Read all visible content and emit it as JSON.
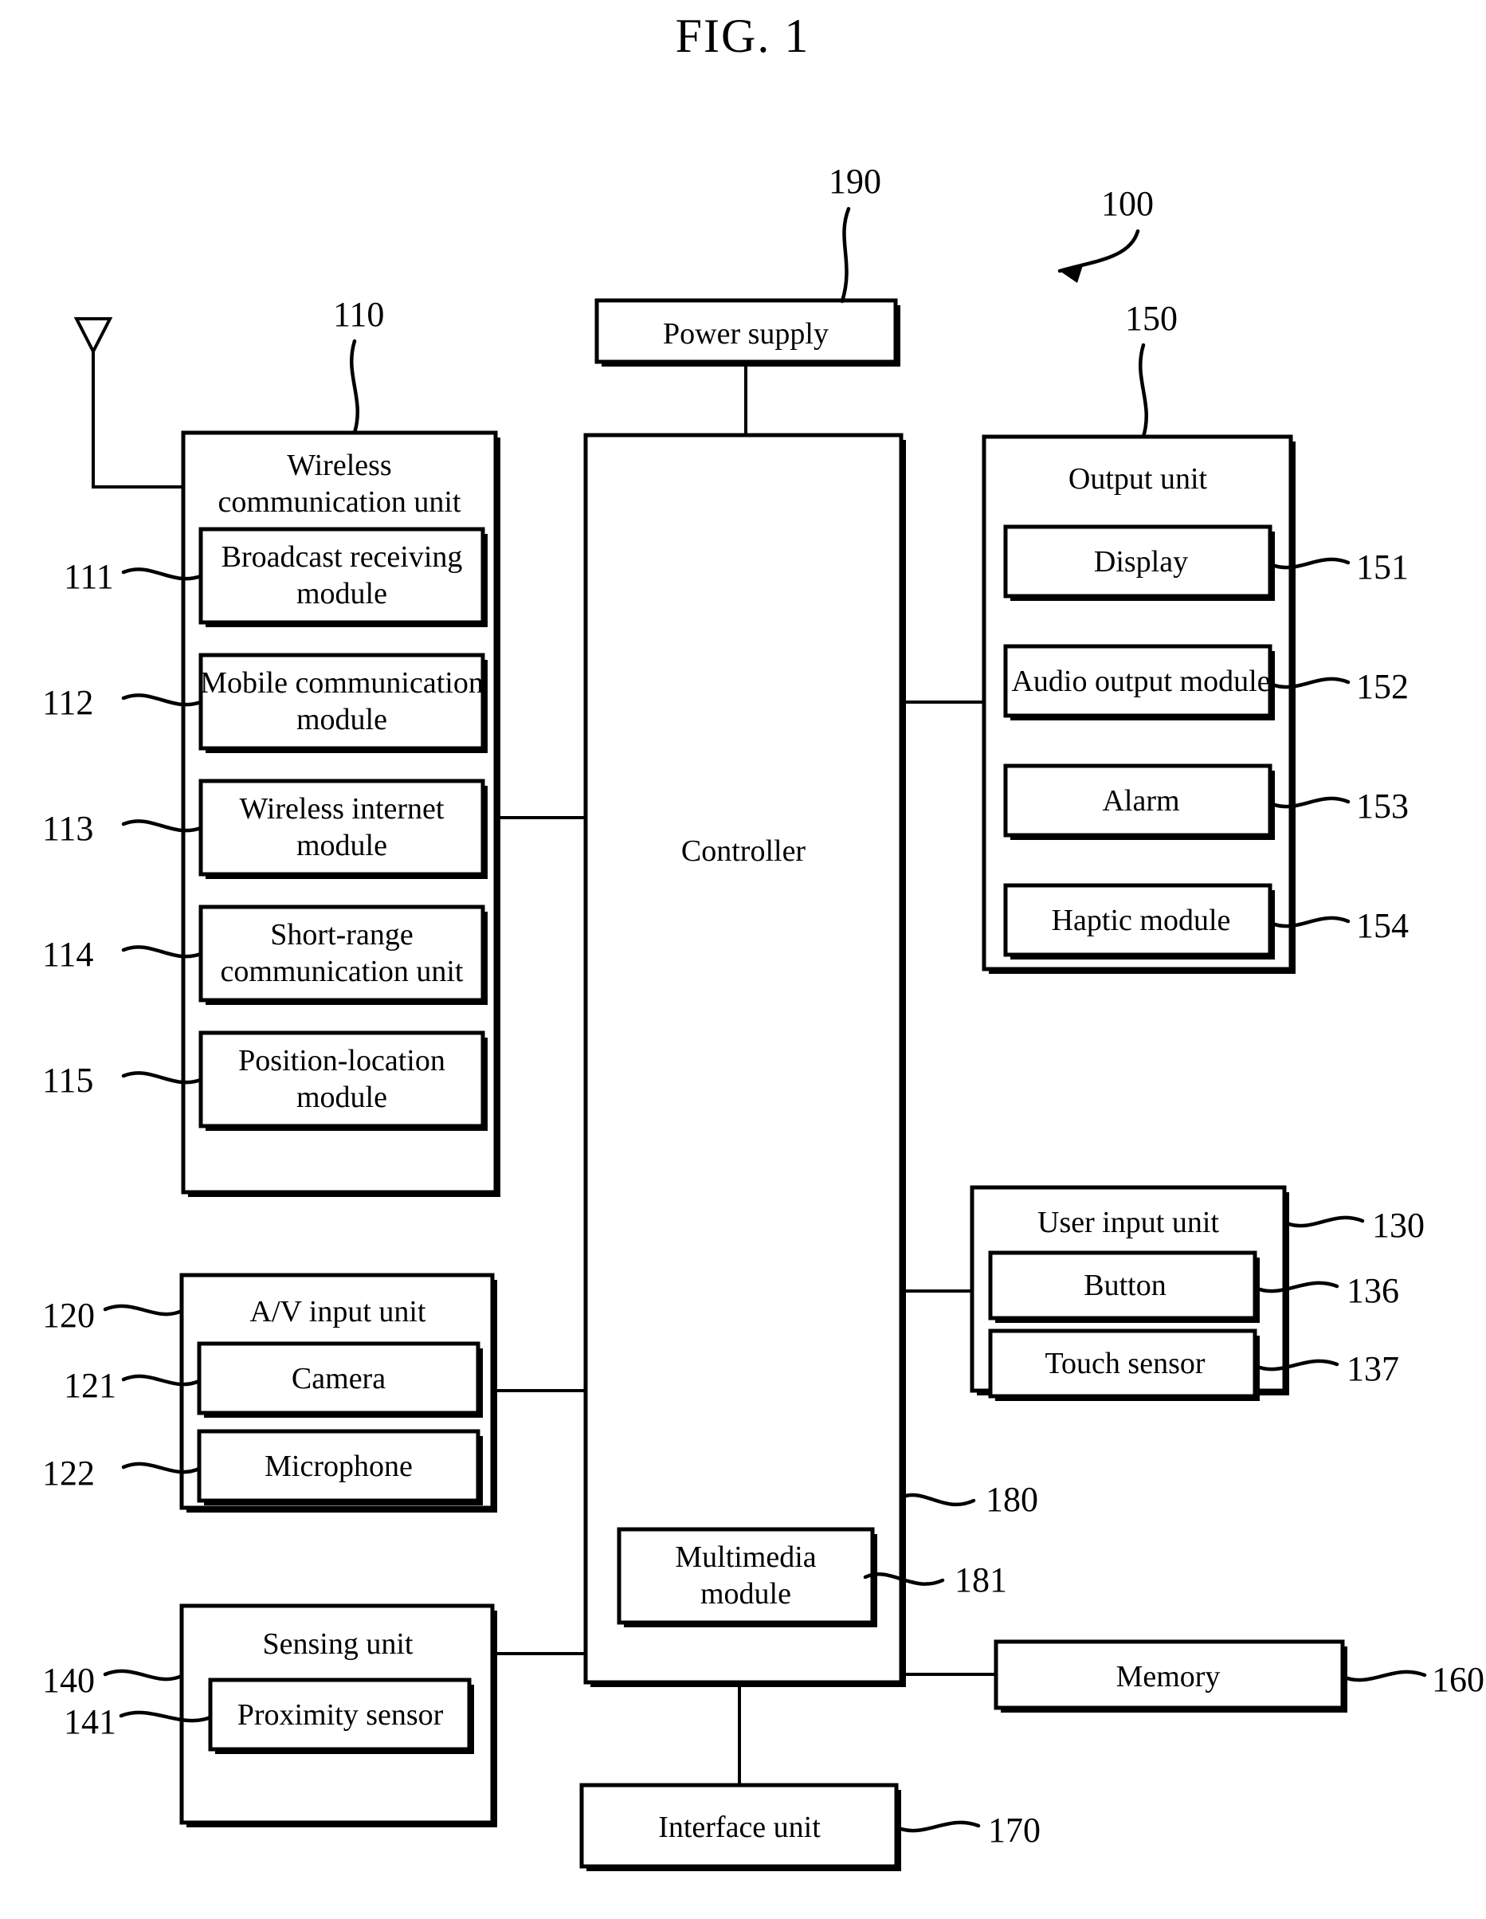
{
  "figure": {
    "title": "FIG. 1",
    "device_ref": "100"
  },
  "blocks": {
    "power_supply": {
      "label": "Power supply",
      "ref": "190"
    },
    "controller": {
      "label": "Controller",
      "ref": "180"
    },
    "multimedia_module": {
      "label": "Multimedia\nmodule",
      "line1": "Multimedia",
      "line2": "module",
      "ref": "181"
    },
    "wireless_communication_unit": {
      "title_line1": "Wireless",
      "title_line2": "communication unit",
      "ref": "110",
      "modules": [
        {
          "line1": "Broadcast receiving",
          "line2": "module",
          "ref": "111"
        },
        {
          "line1": "Mobile communication",
          "line2": "module",
          "ref": "112"
        },
        {
          "line1": "Wireless internet",
          "line2": "module",
          "ref": "113"
        },
        {
          "line1": "Short-range",
          "line2": "communication unit",
          "ref": "114"
        },
        {
          "line1": "Position-location",
          "line2": "module",
          "ref": "115"
        }
      ]
    },
    "av_input_unit": {
      "title": "A/V input unit",
      "ref": "120",
      "modules": [
        {
          "label": "Camera",
          "ref": "121"
        },
        {
          "label": "Microphone",
          "ref": "122"
        }
      ]
    },
    "sensing_unit": {
      "title": "Sensing unit",
      "ref": "140",
      "modules": [
        {
          "label": "Proximity sensor",
          "ref": "141"
        }
      ]
    },
    "output_unit": {
      "title": "Output unit",
      "ref": "150",
      "modules": [
        {
          "label": "Display",
          "ref": "151"
        },
        {
          "label": "Audio output module",
          "ref": "152"
        },
        {
          "label": "Alarm",
          "ref": "153"
        },
        {
          "label": "Haptic module",
          "ref": "154"
        }
      ]
    },
    "user_input_unit": {
      "title": "User input unit",
      "ref": "130",
      "modules": [
        {
          "label": "Button",
          "ref": "136"
        },
        {
          "label": "Touch sensor",
          "ref": "137"
        }
      ]
    },
    "memory": {
      "label": "Memory",
      "ref": "160"
    },
    "interface_unit": {
      "label": "Interface unit",
      "ref": "170"
    }
  },
  "icons": {
    "antenna": "antenna-icon",
    "pointer_arrow": "arrow-icon"
  }
}
